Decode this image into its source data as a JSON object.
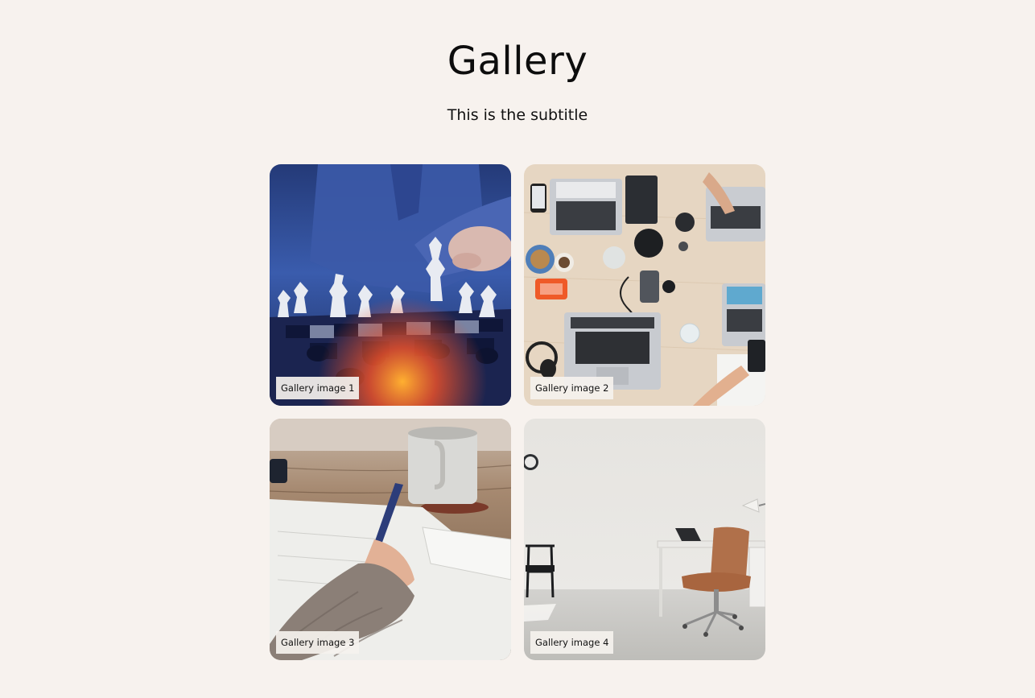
{
  "header": {
    "title": "Gallery",
    "subtitle": "This is the subtitle"
  },
  "gallery": {
    "items": [
      {
        "caption": "Gallery image 1",
        "icon": "chess-photo"
      },
      {
        "caption": "Gallery image 2",
        "icon": "workspace-photo"
      },
      {
        "caption": "Gallery image 3",
        "icon": "writing-photo"
      },
      {
        "caption": "Gallery image 4",
        "icon": "office-photo"
      }
    ]
  },
  "colors": {
    "background": "#f7f2ee",
    "caption_background": "#f5f2ee"
  }
}
